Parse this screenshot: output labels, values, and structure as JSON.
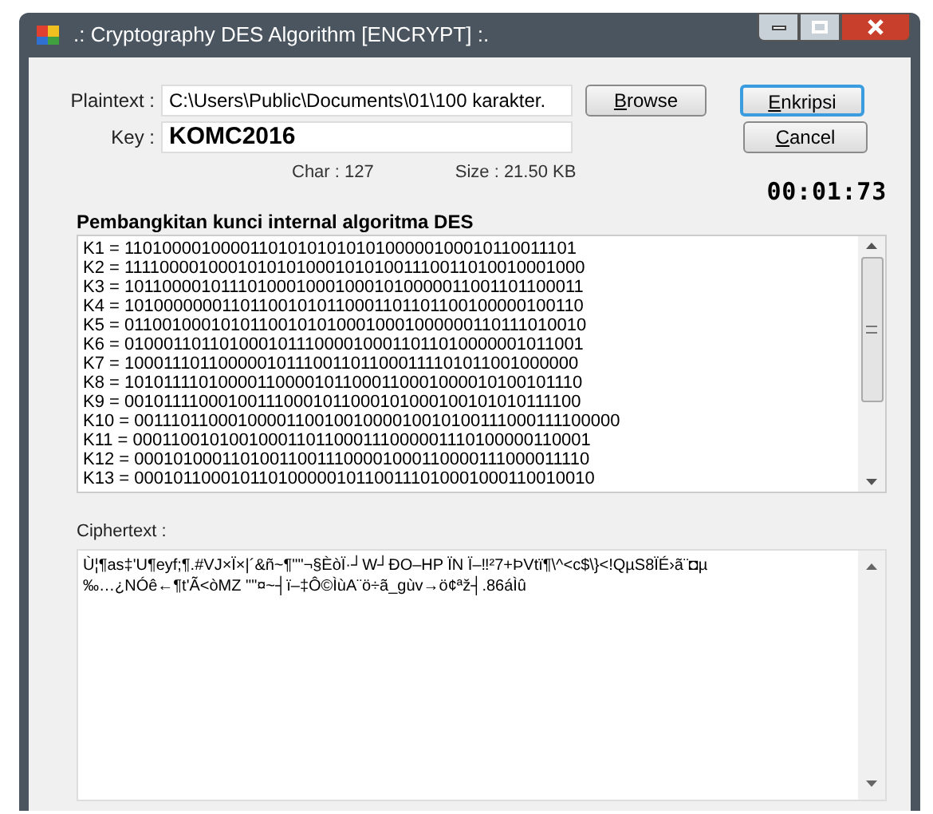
{
  "window": {
    "title": ".: Cryptography DES Algorithm [ENCRYPT] :."
  },
  "plaintext": {
    "label": "Plaintext :",
    "value": "C:\\Users\\Public\\Documents\\01\\100 karakter."
  },
  "key": {
    "label": "Key :",
    "value": "KOMC2016"
  },
  "buttons": [
    {
      "label": "Browse",
      "kind": "browse",
      "focused": false
    },
    {
      "label": "Enkripsi",
      "kind": "action",
      "focused": true
    },
    {
      "label": "Cancel",
      "kind": "action",
      "focused": false
    }
  ],
  "char_count": "Char : 127",
  "size": "Size : 21.50 KB",
  "timer": "00:01:73",
  "keys_heading": "Pembangkitan kunci internal algoritma DES",
  "keys": [
    "K1 = 11010000100001101010101010100000100010110011101",
    "K2 = 111100001000101010100010101001110011010010001000",
    "K3 = 101100001011101000100010001010000011001101100011",
    "K4 = 101000000011011001010110001101101100100000100110",
    "K5 = 011001000101011001010100010001000000110111010010",
    "K6 = 010001101101000101110000100011011010000001011001",
    "K7 = 100011101100000101110011011000111101011001000000",
    "K8 = 101011110100001100001011000110001000010100101110",
    "K9 = 001011110001001110001011000101000100101010111100",
    "K10 = 001110110001000011001001000010010100111000111100000",
    "K11 = 000110010100100011011000111000001110100000110001",
    "K12 = 000101000110100110011100001000110000111000011110",
    "K13 = 000101100010110100000101100111010001000110010010"
  ],
  "cipher_label": "Ciphertext :",
  "ciphertext": "Ù¦¶as‡'U¶eyf;¶.#VJ×Ï×|´&ñ~¶\"\"¬§ÈòÏ·┘W┘ÐO–HP ÏN Ï–‼²7+ÞVtï¶\\^<c$\\}<!QµS8ÏÉ›ã¨◘µ\n‰…¿NÓê←¶t'Ã<òMZ \"\"¤~┤ï–‡Ô©ÌùA¨ö÷ã_gùv→ö¢ªž┤.86áÌû"
}
